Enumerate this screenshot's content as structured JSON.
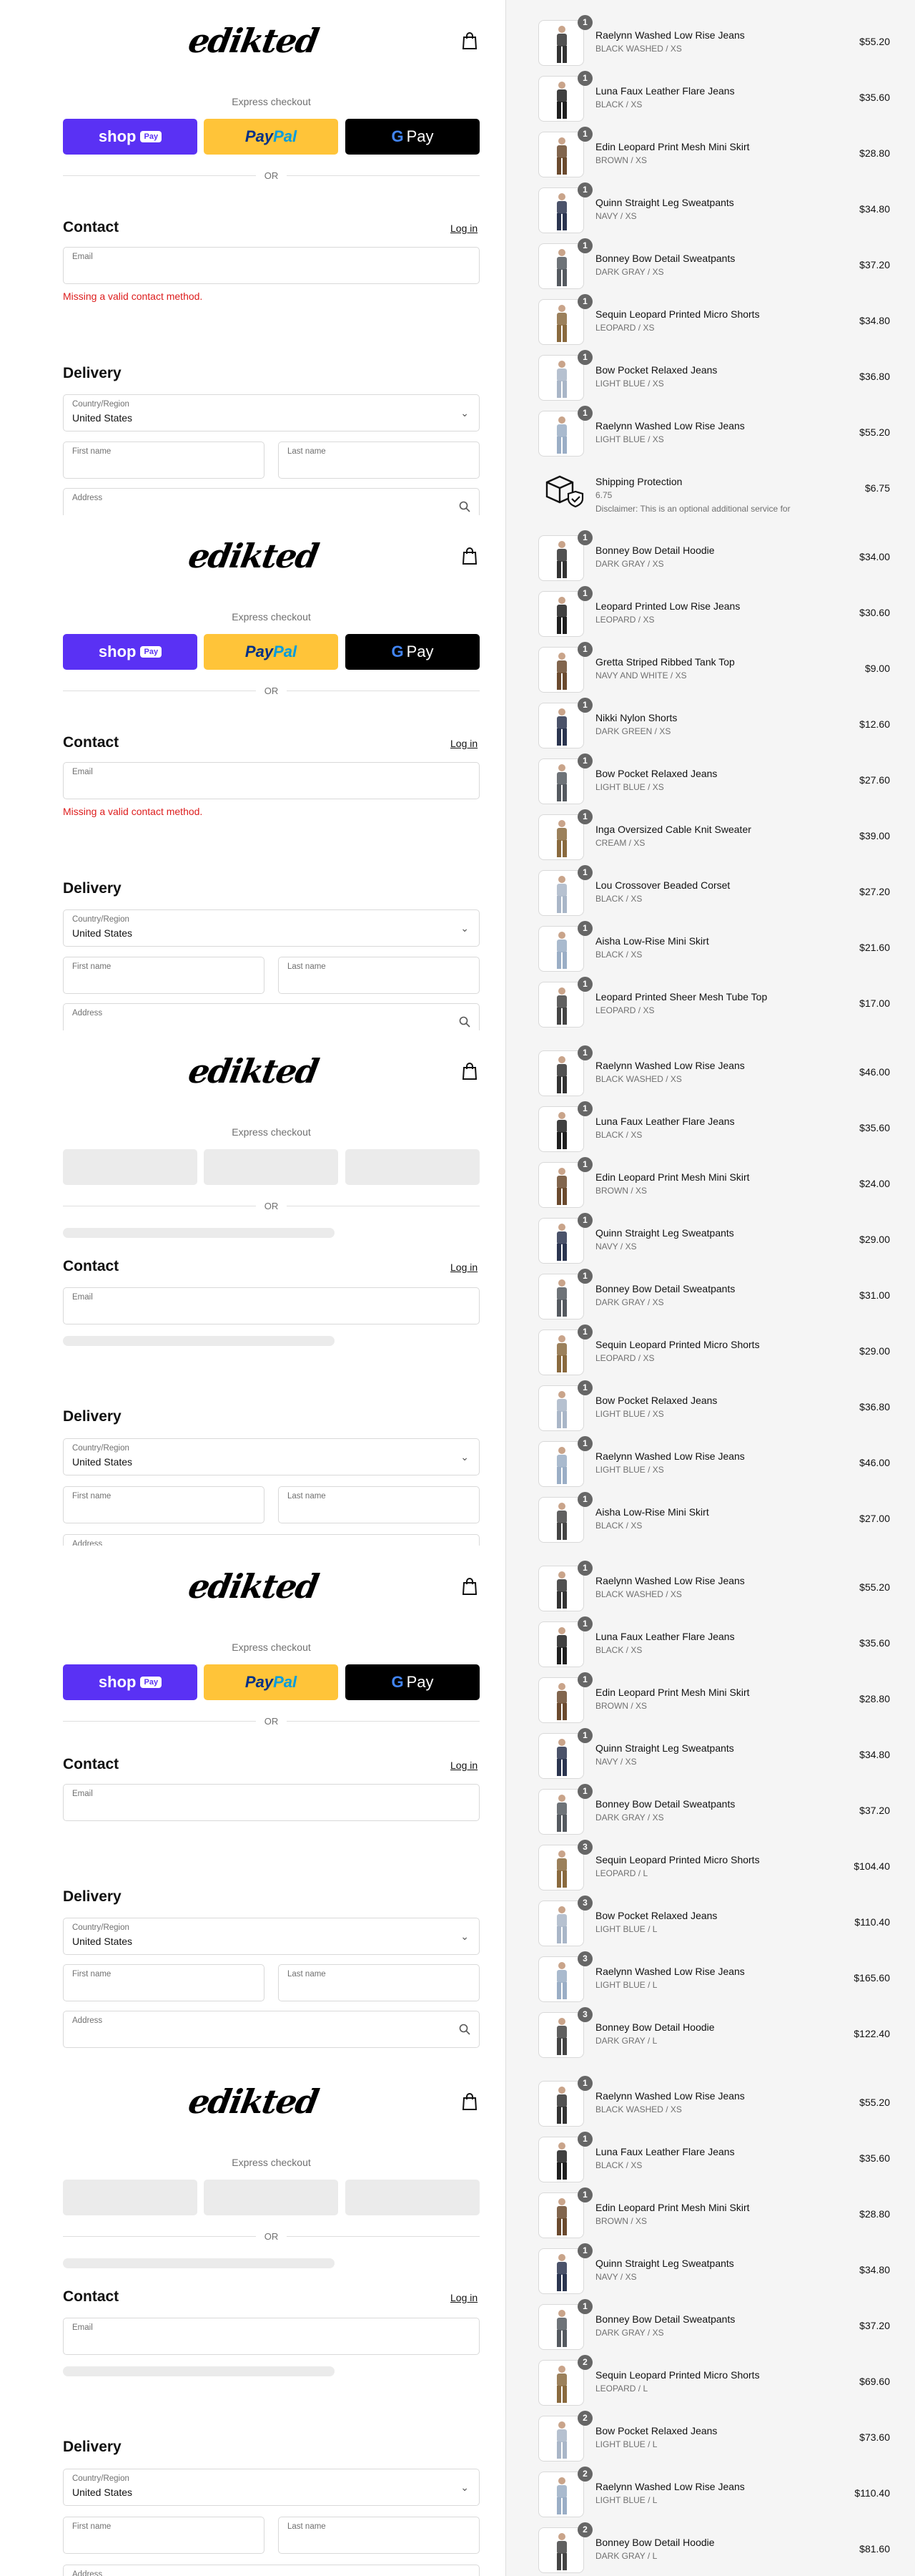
{
  "logo_text": "edikted",
  "express_checkout": "Express checkout",
  "or_text": "OR",
  "shop_pay": {
    "shop": "shop",
    "pay": "Pay"
  },
  "paypal": {
    "pay": "Pay",
    "pal": "Pal"
  },
  "gpay": {
    "g": "G",
    "pay": "Pay"
  },
  "contact": {
    "heading": "Contact",
    "login": "Log in",
    "email_label": "Email",
    "error": "Missing a valid contact method."
  },
  "delivery": {
    "heading": "Delivery",
    "country_label": "Country/Region",
    "country_value": "United States",
    "first_name": "First name",
    "last_name": "Last name",
    "address": "Address"
  },
  "sections": [
    {
      "variant": "loaded-error",
      "items": [
        {
          "qty": "1",
          "name": "Raelynn Washed Low Rise Jeans",
          "variant": "BLACK WASHED / XS",
          "price": "$55.20"
        },
        {
          "qty": "1",
          "name": "Luna Faux Leather Flare Jeans",
          "variant": "BLACK / XS",
          "price": "$35.60"
        },
        {
          "qty": "1",
          "name": "Edin Leopard Print Mesh Mini Skirt",
          "variant": "BROWN / XS",
          "price": "$28.80"
        },
        {
          "qty": "1",
          "name": "Quinn Straight Leg Sweatpants",
          "variant": "NAVY / XS",
          "price": "$34.80"
        },
        {
          "qty": "1",
          "name": "Bonney Bow Detail Sweatpants",
          "variant": "DARK GRAY / XS",
          "price": "$37.20"
        },
        {
          "qty": "1",
          "name": "Sequin Leopard Printed Micro Shorts",
          "variant": "LEOPARD / XS",
          "price": "$34.80"
        },
        {
          "qty": "1",
          "name": "Bow Pocket Relaxed Jeans",
          "variant": "LIGHT BLUE / XS",
          "price": "$36.80"
        },
        {
          "qty": "1",
          "name": "Raelynn Washed Low Rise Jeans",
          "variant": "LIGHT BLUE / XS",
          "price": "$55.20"
        },
        {
          "qty": "",
          "name": "Shipping Protection",
          "variant": "6.75",
          "desc": "Disclaimer: This is an optional additional service for",
          "price": "$6.75",
          "shipping": true
        }
      ]
    },
    {
      "variant": "loaded-error",
      "items": [
        {
          "qty": "1",
          "name": "Bonney Bow Detail Hoodie",
          "variant": "DARK GRAY / XS",
          "price": "$34.00"
        },
        {
          "qty": "1",
          "name": "Leopard Printed Low Rise Jeans",
          "variant": "LEOPARD / XS",
          "price": "$30.60"
        },
        {
          "qty": "1",
          "name": "Gretta Striped Ribbed Tank Top",
          "variant": "NAVY AND WHITE / XS",
          "price": "$9.00"
        },
        {
          "qty": "1",
          "name": "Nikki Nylon Shorts",
          "variant": "DARK GREEN / XS",
          "price": "$12.60"
        },
        {
          "qty": "1",
          "name": "Bow Pocket Relaxed Jeans",
          "variant": "LIGHT BLUE / XS",
          "price": "$27.60"
        },
        {
          "qty": "1",
          "name": "Inga Oversized Cable Knit Sweater",
          "variant": "CREAM / XS",
          "price": "$39.00"
        },
        {
          "qty": "1",
          "name": "Lou Crossover Beaded Corset",
          "variant": "BLACK / XS",
          "price": "$27.20"
        },
        {
          "qty": "1",
          "name": "Aisha Low-Rise Mini Skirt",
          "variant": "BLACK / XS",
          "price": "$21.60"
        },
        {
          "qty": "1",
          "name": "Leopard Printed Sheer Mesh Tube Top",
          "variant": "LEOPARD / XS",
          "price": "$17.00"
        }
      ]
    },
    {
      "variant": "skeleton",
      "items": [
        {
          "qty": "1",
          "name": "Raelynn Washed Low Rise Jeans",
          "variant": "BLACK WASHED / XS",
          "price": "$46.00"
        },
        {
          "qty": "1",
          "name": "Luna Faux Leather Flare Jeans",
          "variant": "BLACK / XS",
          "price": "$35.60"
        },
        {
          "qty": "1",
          "name": "Edin Leopard Print Mesh Mini Skirt",
          "variant": "BROWN / XS",
          "price": "$24.00"
        },
        {
          "qty": "1",
          "name": "Quinn Straight Leg Sweatpants",
          "variant": "NAVY / XS",
          "price": "$29.00"
        },
        {
          "qty": "1",
          "name": "Bonney Bow Detail Sweatpants",
          "variant": "DARK GRAY / XS",
          "price": "$31.00"
        },
        {
          "qty": "1",
          "name": "Sequin Leopard Printed Micro Shorts",
          "variant": "LEOPARD / XS",
          "price": "$29.00"
        },
        {
          "qty": "1",
          "name": "Bow Pocket Relaxed Jeans",
          "variant": "LIGHT BLUE / XS",
          "price": "$36.80"
        },
        {
          "qty": "1",
          "name": "Raelynn Washed Low Rise Jeans",
          "variant": "LIGHT BLUE / XS",
          "price": "$46.00"
        },
        {
          "qty": "1",
          "name": "Aisha Low-Rise Mini Skirt",
          "variant": "BLACK / XS",
          "price": "$27.00"
        }
      ]
    },
    {
      "variant": "loaded",
      "items": [
        {
          "qty": "1",
          "name": "Raelynn Washed Low Rise Jeans",
          "variant": "BLACK WASHED / XS",
          "price": "$55.20"
        },
        {
          "qty": "1",
          "name": "Luna Faux Leather Flare Jeans",
          "variant": "BLACK / XS",
          "price": "$35.60"
        },
        {
          "qty": "1",
          "name": "Edin Leopard Print Mesh Mini Skirt",
          "variant": "BROWN / XS",
          "price": "$28.80"
        },
        {
          "qty": "1",
          "name": "Quinn Straight Leg Sweatpants",
          "variant": "NAVY / XS",
          "price": "$34.80"
        },
        {
          "qty": "1",
          "name": "Bonney Bow Detail Sweatpants",
          "variant": "DARK GRAY / XS",
          "price": "$37.20"
        },
        {
          "qty": "3",
          "name": "Sequin Leopard Printed Micro Shorts",
          "variant": "LEOPARD / L",
          "price": "$104.40"
        },
        {
          "qty": "3",
          "name": "Bow Pocket Relaxed Jeans",
          "variant": "LIGHT BLUE / L",
          "price": "$110.40"
        },
        {
          "qty": "3",
          "name": "Raelynn Washed Low Rise Jeans",
          "variant": "LIGHT BLUE / L",
          "price": "$165.60"
        },
        {
          "qty": "3",
          "name": "Bonney Bow Detail Hoodie",
          "variant": "DARK GRAY / L",
          "price": "$122.40"
        }
      ]
    },
    {
      "variant": "skeleton",
      "items": [
        {
          "qty": "1",
          "name": "Raelynn Washed Low Rise Jeans",
          "variant": "BLACK WASHED / XS",
          "price": "$55.20"
        },
        {
          "qty": "1",
          "name": "Luna Faux Leather Flare Jeans",
          "variant": "BLACK / XS",
          "price": "$35.60"
        },
        {
          "qty": "1",
          "name": "Edin Leopard Print Mesh Mini Skirt",
          "variant": "BROWN / XS",
          "price": "$28.80"
        },
        {
          "qty": "1",
          "name": "Quinn Straight Leg Sweatpants",
          "variant": "NAVY / XS",
          "price": "$34.80"
        },
        {
          "qty": "1",
          "name": "Bonney Bow Detail Sweatpants",
          "variant": "DARK GRAY / XS",
          "price": "$37.20"
        },
        {
          "qty": "2",
          "name": "Sequin Leopard Printed Micro Shorts",
          "variant": "LEOPARD / L",
          "price": "$69.60"
        },
        {
          "qty": "2",
          "name": "Bow Pocket Relaxed Jeans",
          "variant": "LIGHT BLUE / L",
          "price": "$73.60"
        },
        {
          "qty": "2",
          "name": "Raelynn Washed Low Rise Jeans",
          "variant": "LIGHT BLUE / L",
          "price": "$110.40"
        },
        {
          "qty": "2",
          "name": "Bonney Bow Detail Hoodie",
          "variant": "DARK GRAY / L",
          "price": "$81.60"
        }
      ]
    }
  ],
  "colors": {
    "accent_shop": "#5a31f4",
    "paypal": "#ffc439",
    "error": "#dd1d1d",
    "sidebar_bg": "#f5f5f5"
  }
}
